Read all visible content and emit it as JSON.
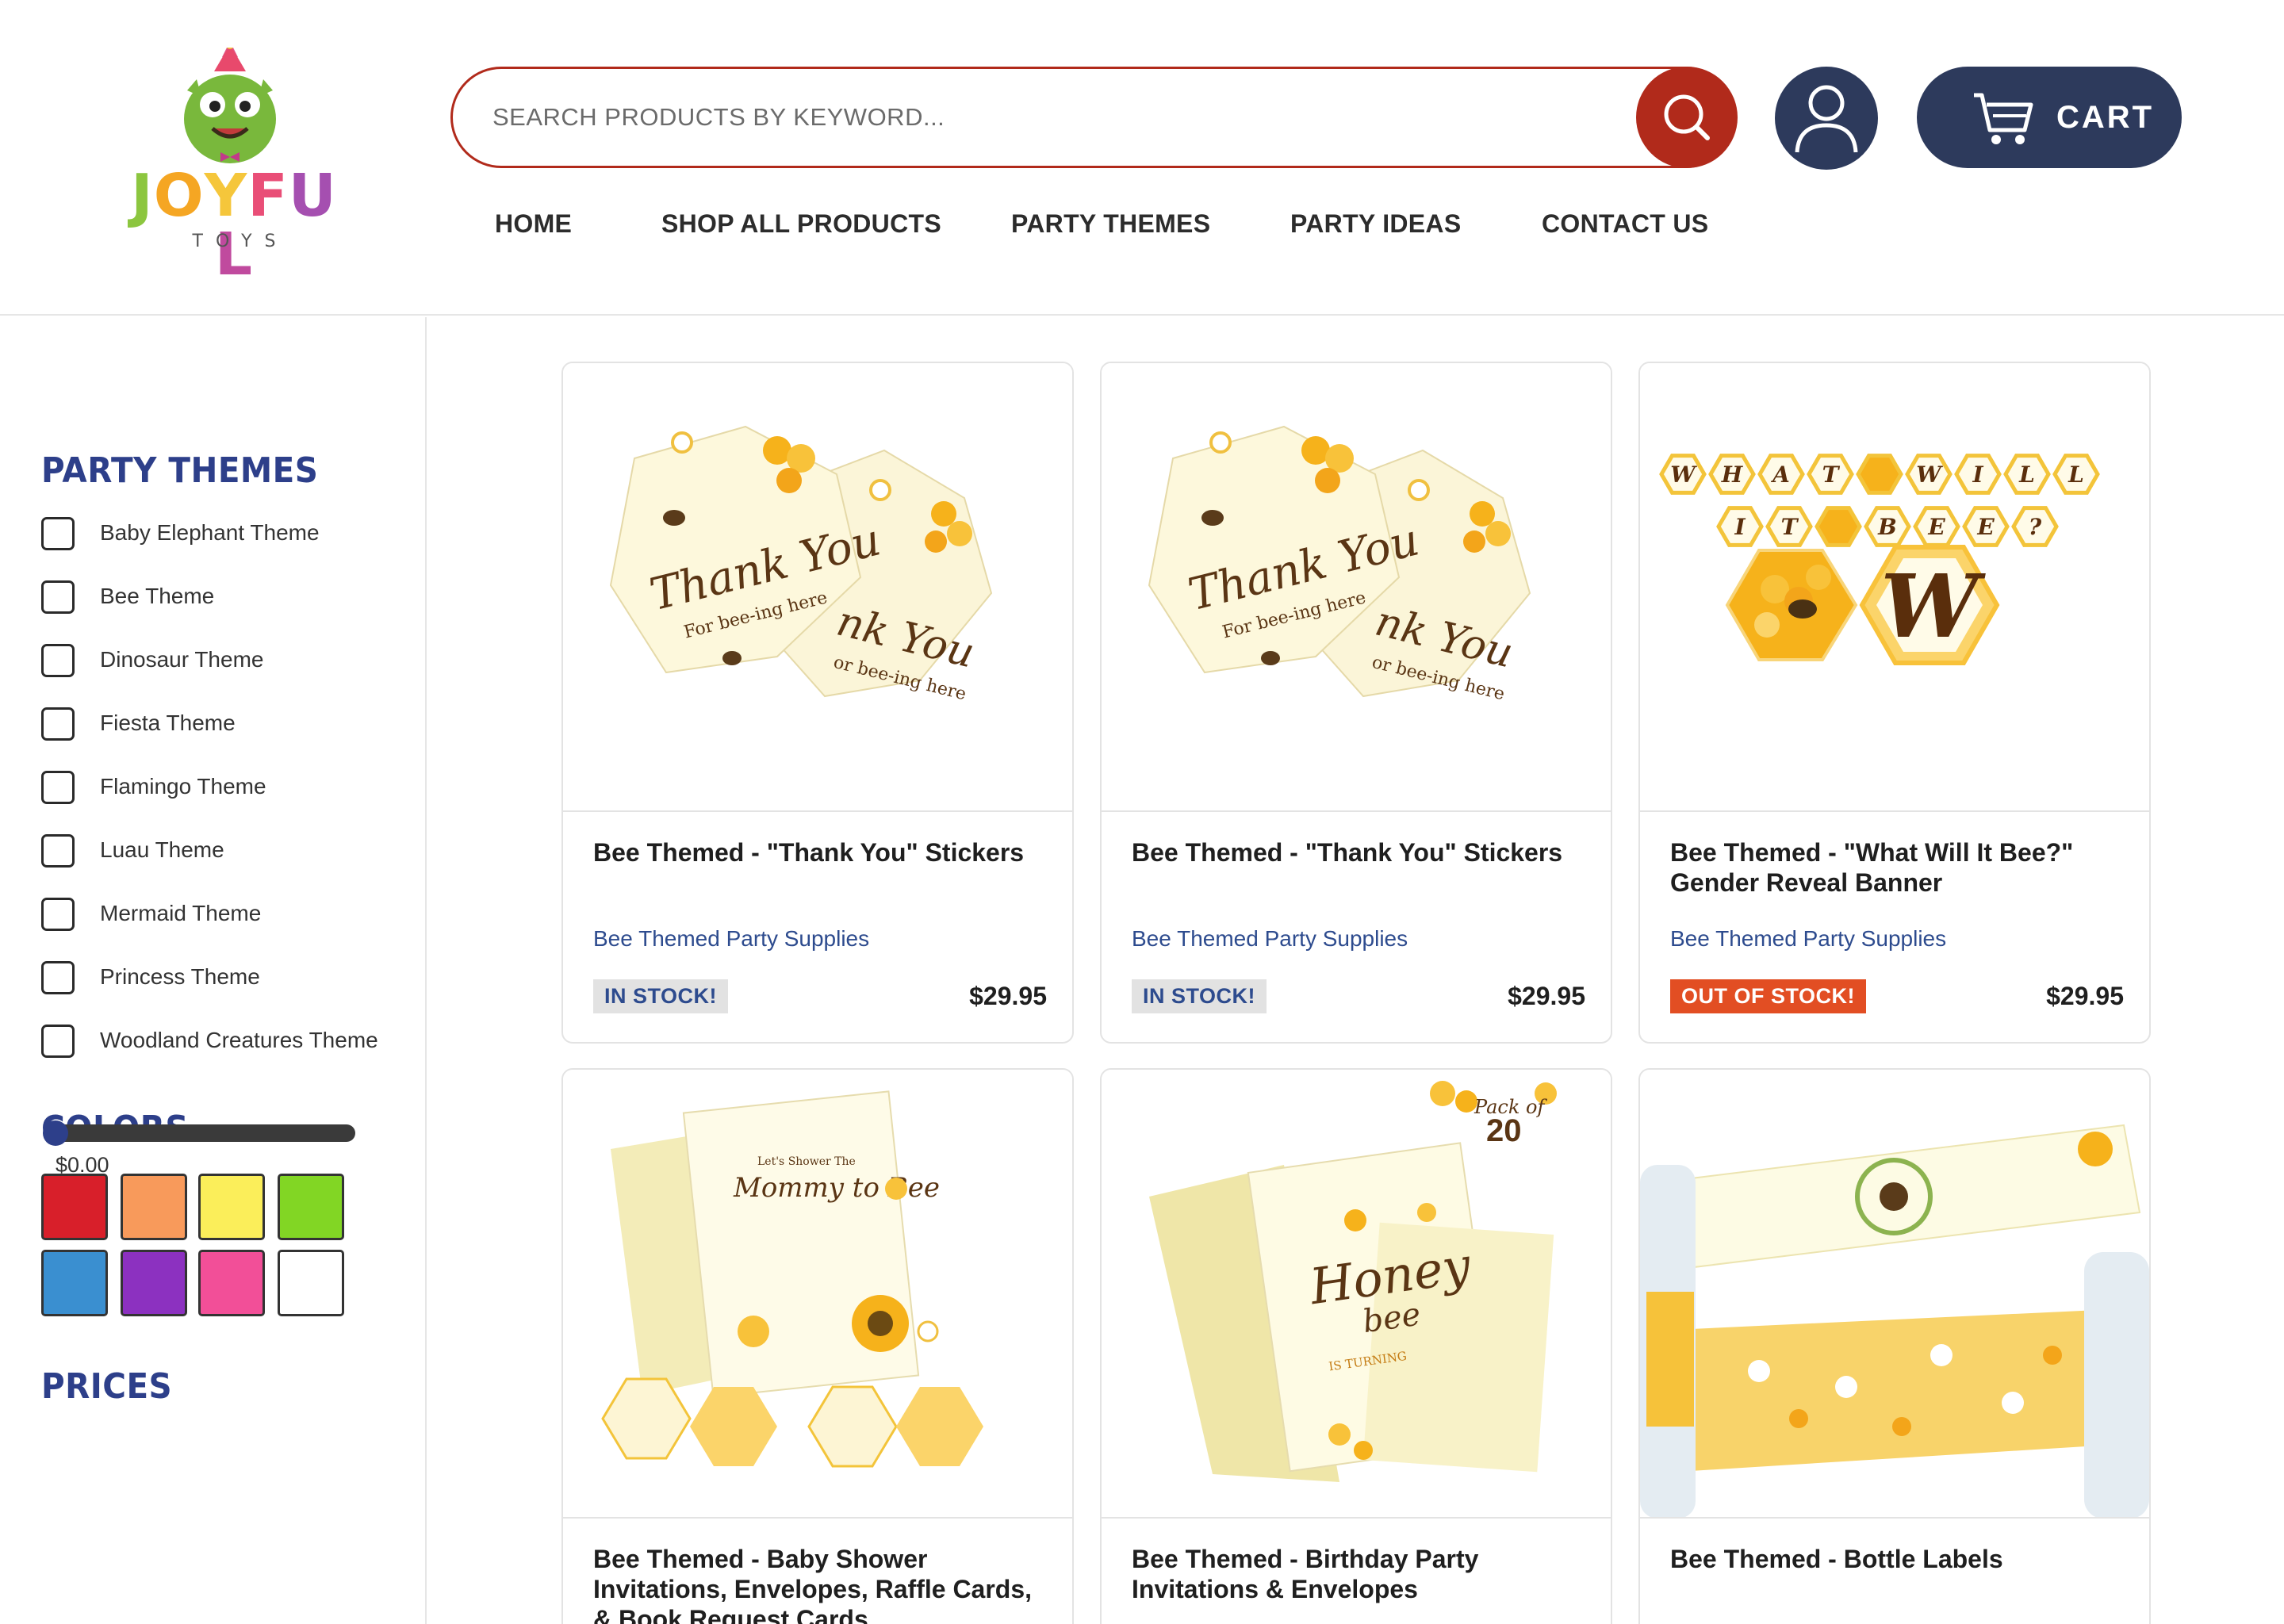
{
  "brand": {
    "logo_text": "JOYFUL",
    "logo_subtext": "TOYS"
  },
  "search": {
    "placeholder": "SEARCH PRODUCTS BY KEYWORD...",
    "value": ""
  },
  "header": {
    "cart_label": "CART",
    "search_icon": "search-icon",
    "account_icon": "user-icon",
    "cart_icon": "cart-icon"
  },
  "nav": [
    "HOME",
    "SHOP ALL PRODUCTS",
    "PARTY THEMES",
    "PARTY IDEAS",
    "CONTACT US"
  ],
  "sidebar": {
    "themes_heading": "PARTY THEMES",
    "themes": [
      "Baby Elephant Theme",
      "Bee Theme",
      "Dinosaur Theme",
      "Fiesta Theme",
      "Flamingo Theme",
      "Luau Theme",
      "Mermaid Theme",
      "Princess Theme",
      "Woodland Creatures Theme"
    ],
    "colors_heading": "COLORS",
    "colors": [
      "#d81f2a",
      "#f89a5b",
      "#fbee5a",
      "#82d624",
      "#3a8fd0",
      "#8c31c0",
      "#f24f98",
      "#ffffff"
    ],
    "prices_heading": "PRICES",
    "price_min": "$0.00",
    "price_slider_fraction": 0.0
  },
  "products": [
    {
      "title": "Bee Themed - \"Thank You\" Stickers",
      "category": "Bee Themed Party Supplies",
      "stock": "IN STOCK!",
      "price": "$29.95"
    },
    {
      "title": "Bee Themed - \"Thank You\" Stickers",
      "category": "Bee Themed Party Supplies",
      "stock": "IN STOCK!",
      "price": "$29.95"
    },
    {
      "title": "Bee Themed - \"What Will It Bee?\" Gender Reveal Banner",
      "category": "Bee Themed Party Supplies",
      "stock": "OUT OF STOCK!",
      "price": "$29.95"
    },
    {
      "title": "Bee Themed - Baby Shower Invitations, Envelopes, Raffle Cards, & Book Request Cards"
    },
    {
      "title": "Bee Themed - Birthday Party Invitations & Envelopes"
    },
    {
      "title": "Bee Themed - Bottle Labels"
    }
  ],
  "images": {
    "thank_you_main": "Thank You",
    "thank_you_sub": "For bee-ing here",
    "thank_you_back_main": "nk You",
    "thank_you_back_sub": "or bee-ing here",
    "banner_row1": [
      "W",
      "H",
      "A",
      "T",
      "",
      "W",
      "I",
      "L",
      "L"
    ],
    "banner_row2": [
      "I",
      "T",
      "",
      "B",
      "E",
      "E",
      "?"
    ],
    "banner_big_letter": "W",
    "shower_script": "Mommy to Bee",
    "shower_header": "Let's Shower The",
    "pack_of": "Pack of",
    "pack_count": "20",
    "honey_word": "Honey",
    "bee_word": "bee",
    "is_turning": "IS TURNING"
  }
}
